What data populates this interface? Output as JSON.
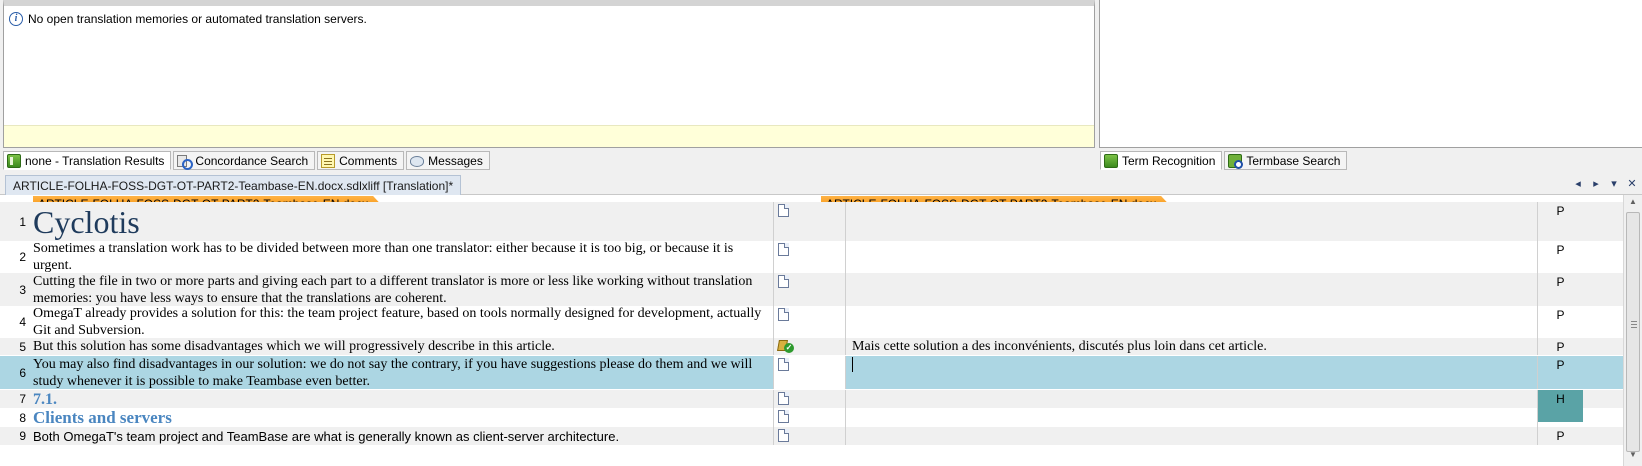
{
  "tm_pane": {
    "message": "No open translation memories or automated translation servers."
  },
  "tabs_left": [
    {
      "label": "none - Translation Results",
      "icon": "book-icon"
    },
    {
      "label": "Concordance Search",
      "icon": "concordance-icon"
    },
    {
      "label": "Comments",
      "icon": "comments-icon"
    },
    {
      "label": "Messages",
      "icon": "messages-icon"
    }
  ],
  "tabs_right": [
    {
      "label": "Term Recognition",
      "icon": "term-recognition-icon"
    },
    {
      "label": "Termbase Search",
      "icon": "termbase-search-icon"
    }
  ],
  "document_tab": {
    "title": "ARTICLE-FOLHA-FOSS-DGT-OT-PART2-Teambase-EN.docx.sdlxliff [Translation]*"
  },
  "nav": {
    "prev": "◂",
    "next": "▸",
    "menu": "▾",
    "close": "✕"
  },
  "file_header": {
    "source_file": "ARTICLE-FOLHA-FOSS-DGT-OT-PART2-Teambase-EN.docx",
    "target_file": "ARTICLE-FOLHA-FOSS-DGT-OT-PART2-Teambase-EN.docx"
  },
  "segments": [
    {
      "num": "1",
      "source": "Cyclotis",
      "target": "",
      "type": "P",
      "status": "draft"
    },
    {
      "num": "2",
      "source": "Sometimes a translation work has to be divided between more than one translator: either because it is too big, or because it is urgent.",
      "target": "",
      "type": "P",
      "status": "draft"
    },
    {
      "num": "3",
      "source": "Cutting the file in two or more parts and giving each part to a different translator is more or less like working without translation memories: you have less ways to ensure that the translations are coherent.",
      "target": "",
      "type": "P",
      "status": "draft"
    },
    {
      "num": "4",
      "source": "OmegaT already provides a solution for this: the team project feature, based on tools normally designed for development, actually Git and Subversion.",
      "target": "",
      "type": "P",
      "status": "draft"
    },
    {
      "num": "5",
      "source": "But this solution has some disadvantages which we will progressively describe in this article.",
      "target": "Mais cette solution a des inconvénients, discutés plus loin dans cet article.",
      "type": "P",
      "status": "translated"
    },
    {
      "num": "6",
      "source": "You may also find disadvantages in our solution: we do not say the contrary, if you have suggestions please do them and we will study whenever it is possible to make Teambase even better.",
      "target": "",
      "type": "P",
      "status": "draft"
    },
    {
      "num": "7",
      "source": "7.1.",
      "target": "",
      "type": "H",
      "status": "draft"
    },
    {
      "num": "8",
      "source": "Clients and servers",
      "target": "",
      "type": "",
      "status": "draft"
    },
    {
      "num": "9",
      "source": "Both OmegaT's team project and TeamBase are what is generally known as client-server architecture.",
      "target": "",
      "type": "P",
      "status": "draft"
    }
  ]
}
